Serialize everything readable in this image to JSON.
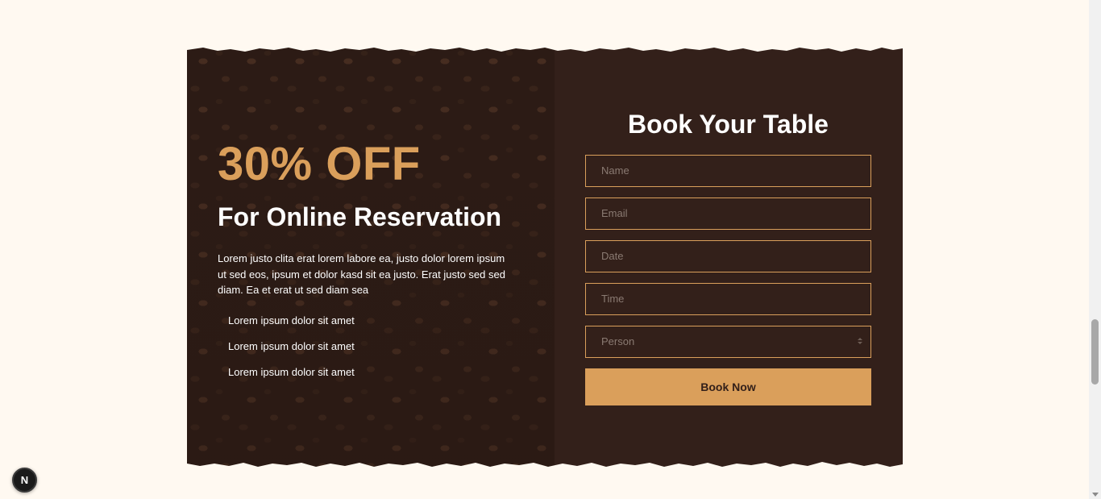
{
  "offer": {
    "title": "30% OFF",
    "subtitle": "For Online Reservation",
    "text": "Lorem justo clita erat lorem labore ea, justo dolor lorem ipsum ut sed eos, ipsum et dolor kasd sit ea justo. Erat justo sed sed diam. Ea et erat ut sed diam sea",
    "list": [
      "Lorem ipsum dolor sit amet",
      "Lorem ipsum dolor sit amet",
      "Lorem ipsum dolor sit amet"
    ]
  },
  "form": {
    "title": "Book Your Table",
    "name_placeholder": "Name",
    "email_placeholder": "Email",
    "date_placeholder": "Date",
    "time_placeholder": "Time",
    "person_selected": "Person",
    "button_label": "Book Now"
  },
  "dev_badge": {
    "label": "N"
  },
  "colors": {
    "accent": "#da9f5b",
    "background": "#fff9f1",
    "panel_dark": "#33201a",
    "text_light": "#ffffff"
  },
  "icons": {
    "select_arrows": "select-arrows-icon"
  }
}
